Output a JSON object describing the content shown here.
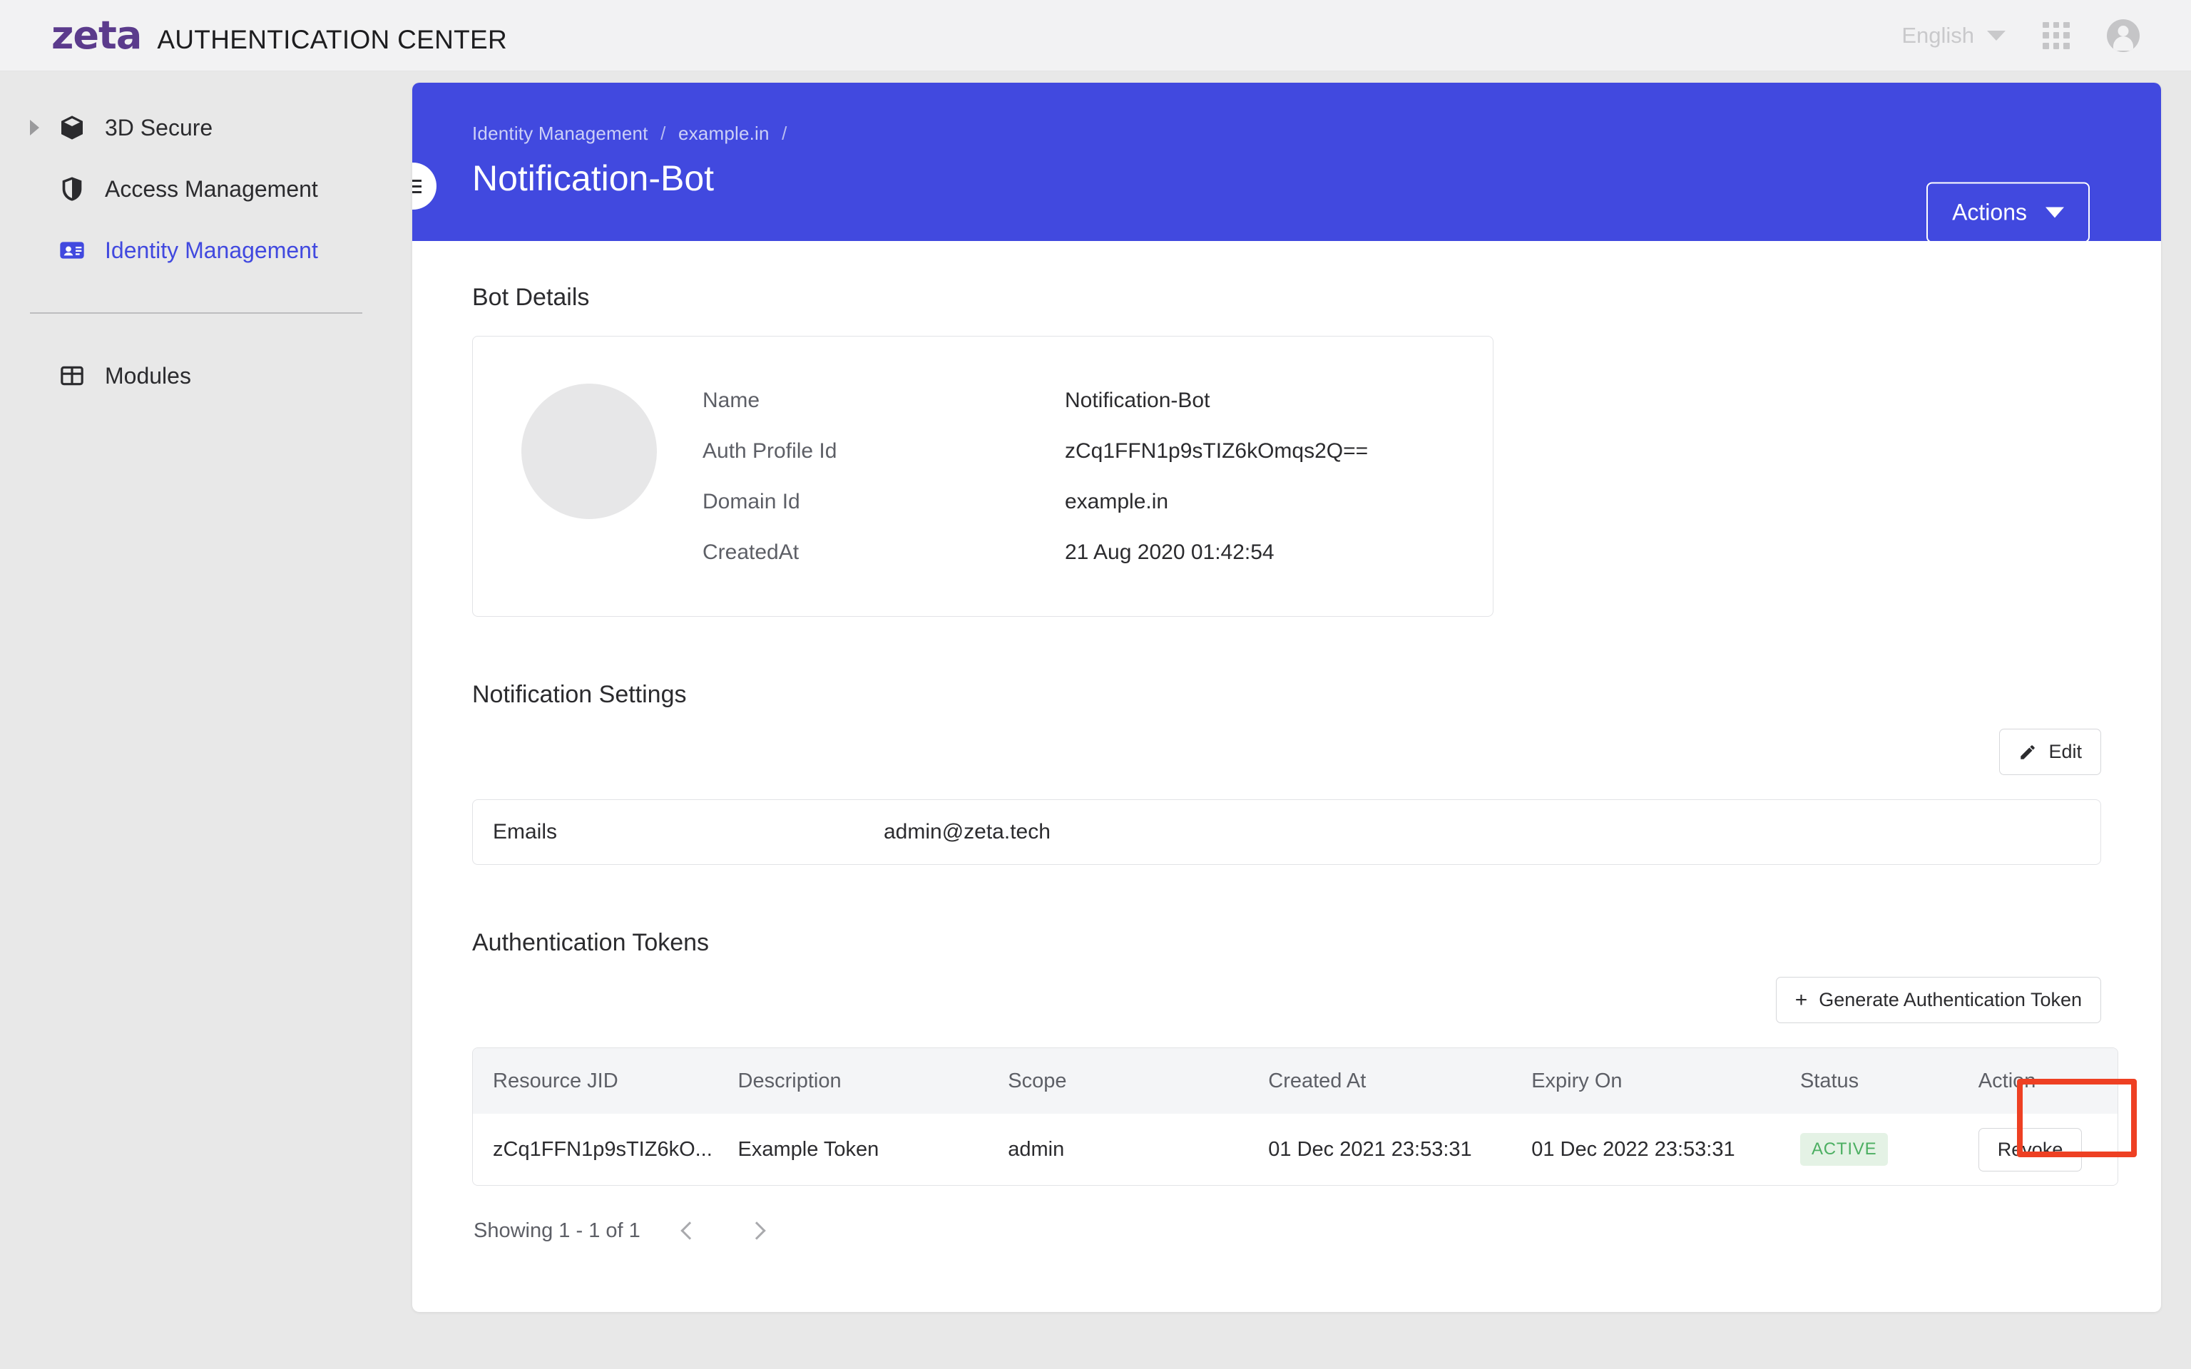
{
  "topbar": {
    "brand_mark": "zeta",
    "brand_title": "AUTHENTICATION CENTER",
    "language": "English",
    "apps_icon": "grid-apps-icon",
    "account_icon": "user-avatar-icon"
  },
  "sidebar": {
    "items": [
      {
        "label": "3D Secure",
        "icon": "cube-icon",
        "expandable": true,
        "active": false
      },
      {
        "label": "Access Management",
        "icon": "shield-icon",
        "expandable": false,
        "active": false
      },
      {
        "label": "Identity Management",
        "icon": "contact-card-icon",
        "expandable": false,
        "active": true
      }
    ],
    "secondary_items": [
      {
        "label": "Modules",
        "icon": "grid-table-icon",
        "expandable": false,
        "active": false
      }
    ]
  },
  "panel": {
    "breadcrumb": {
      "first": "Identity Management",
      "second": "example.in",
      "separator": "/"
    },
    "title": "Notification-Bot",
    "actions_label": "Actions",
    "menu_toggle_icon": "hamburger-icon"
  },
  "bot_details": {
    "heading": "Bot Details",
    "rows": [
      {
        "key": "Name",
        "value": "Notification-Bot"
      },
      {
        "key": "Auth Profile Id",
        "value": "zCq1FFN1p9sTIZ6kOmqs2Q=="
      },
      {
        "key": "Domain Id",
        "value": "example.in"
      },
      {
        "key": "CreatedAt",
        "value": "21 Aug 2020 01:42:54"
      }
    ]
  },
  "notification_settings": {
    "heading": "Notification Settings",
    "edit_label": "Edit",
    "edit_icon": "pencil-icon",
    "emails_key": "Emails",
    "emails_value": "admin@zeta.tech"
  },
  "auth_tokens": {
    "heading": "Authentication Tokens",
    "generate_label": "Generate Authentication Token",
    "generate_prefix": "+",
    "columns": [
      "Resource JID",
      "Description",
      "Scope",
      "Created At",
      "Expiry On",
      "Status",
      "Action"
    ],
    "rows": [
      {
        "resource_jid": "zCq1FFN1p9sTIZ6kO...",
        "description": "Example Token",
        "scope": "admin",
        "created_at": "01 Dec 2021 23:53:31",
        "expiry_on": "01 Dec 2022 23:53:31",
        "status": "ACTIVE",
        "action": "Revoke"
      }
    ],
    "pagination": {
      "showing": "Showing  1 - 1  of  1",
      "prev_icon": "chevron-left-icon",
      "next_icon": "chevron-right-icon"
    }
  },
  "annotation": {
    "highlight_target": "revoke-button",
    "color": "#ee4023"
  },
  "colors": {
    "brand_purple": "#5b3b8c",
    "accent_blue": "#4149df",
    "page_bg": "#e8e8e8",
    "status_green_text": "#4caf62",
    "status_green_bg": "#e4f2e5",
    "highlight_red": "#ee4023"
  }
}
